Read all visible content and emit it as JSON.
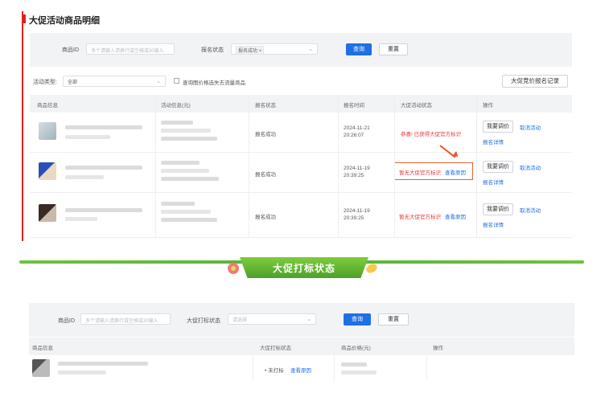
{
  "top_section": {
    "title": "大促活动商品明细",
    "filters": {
      "product_id_label": "商品ID",
      "product_id_placeholder": "多个请输入请换行或空格或30输入",
      "status_label": "报名状态",
      "status_tag": "报名成功",
      "status_tag_close": "×",
      "search_button": "查询",
      "reset_button": "重置"
    },
    "activity_type_label": "活动类型:",
    "activity_type_value": "全部",
    "checkbox_label": "查询图价格选失去流量商品",
    "record_button": "大促竞价报名记录",
    "table_headers": [
      "商品信息",
      "活动信息(元)",
      "报名状态",
      "报名时间",
      "大促活动状态",
      "操作"
    ],
    "rows": [
      {
        "status": "报名成功",
        "date": "2024-11-21",
        "time": "20:26:07",
        "promo_status": "恭喜! 已获得大促官方标识",
        "promo_link": "",
        "adjust_button": "我要调价",
        "cancel_link": "取消活动",
        "detail_link": "报名详情",
        "thumb_colors": [
          "#d7dde0",
          "#9fb4bd"
        ]
      },
      {
        "status": "报名成功",
        "date": "2024-11-19",
        "time": "20:39:25",
        "promo_status": "暂无大促官方标识",
        "promo_link": "查看原因",
        "adjust_button": "我要调价",
        "cancel_link": "取消活动",
        "detail_link": "报名详情",
        "thumb_colors": [
          "#2b4fb8",
          "#e9d9c2"
        ]
      },
      {
        "status": "报名成功",
        "date": "2024-11-19",
        "time": "20:39:25",
        "promo_status": "暂无大促官方标识",
        "promo_link": "查看原因",
        "adjust_button": "我要调价",
        "cancel_link": "取消活动",
        "detail_link": "报名详情",
        "thumb_colors": [
          "#3a2a26",
          "#c9b9a8"
        ]
      }
    ]
  },
  "banner": {
    "title": "大促打标状态"
  },
  "bottom_section": {
    "filters": {
      "product_id_label": "商品ID",
      "product_id_placeholder": "多个请输入请换行或空格或30输入",
      "promo_status_label": "大促打标状态",
      "promo_status_placeholder": "请选择",
      "search_button": "查询",
      "reset_button": "重置"
    },
    "table_headers": [
      "商品信息",
      "大促打标状态",
      "商品价格(元)",
      "操作"
    ],
    "rows": [
      {
        "status_prefix": "•",
        "status": "未打标",
        "status_link": "查看原因"
      }
    ]
  },
  "colors": {
    "accent_red": "#e02020",
    "primary_blue": "#1f6fe5",
    "banner_green": "#56b33a",
    "highlight_orange": "#e8622a"
  }
}
